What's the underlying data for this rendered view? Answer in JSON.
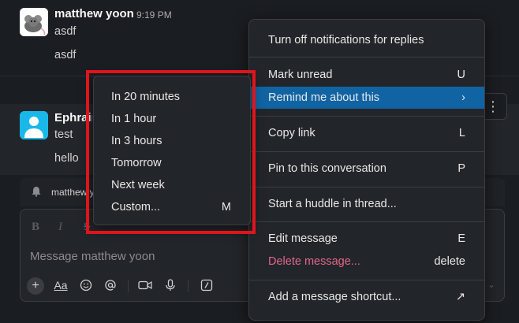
{
  "messages": [
    {
      "author": "matthew yoon",
      "time": "9:19 PM",
      "lines": [
        "asdf",
        "asdf"
      ],
      "avatar": "rat-avatar"
    },
    {
      "author": "Ephraim",
      "lines": [
        "test",
        "hello"
      ],
      "avatar": "user-avatar"
    }
  ],
  "thread_reply": {
    "name": "matthew yoon"
  },
  "composer": {
    "placeholder": "Message matthew yoon",
    "format_icons": [
      "B",
      "I",
      "S"
    ],
    "tools": [
      "+",
      "Aa"
    ]
  },
  "context_menu": {
    "items": [
      {
        "label": "Turn off notifications for replies",
        "key": ""
      },
      {
        "label": "Mark unread",
        "key": "U"
      },
      {
        "label": "Remind me about this",
        "key": "›",
        "active": true
      },
      {
        "label": "Copy link",
        "key": "L"
      },
      {
        "label": "Pin to this conversation",
        "key": "P"
      },
      {
        "label": "Start a huddle in thread...",
        "key": ""
      },
      {
        "label": "Edit message",
        "key": "E"
      },
      {
        "label": "Delete message...",
        "key": "delete",
        "danger": true
      },
      {
        "label": "Add a message shortcut...",
        "key": "↗"
      }
    ]
  },
  "remind_submenu": {
    "items": [
      {
        "label": "In 20 minutes",
        "key": ""
      },
      {
        "label": "In 1 hour",
        "key": ""
      },
      {
        "label": "In 3 hours",
        "key": ""
      },
      {
        "label": "Tomorrow",
        "key": ""
      },
      {
        "label": "Next week",
        "key": ""
      },
      {
        "label": "Custom...",
        "key": "M"
      }
    ]
  },
  "colors": {
    "background": "#1a1d21",
    "menu_bg": "#222529",
    "active": "#1164a3",
    "danger": "#e3668c",
    "highlight": "#e0141c"
  }
}
